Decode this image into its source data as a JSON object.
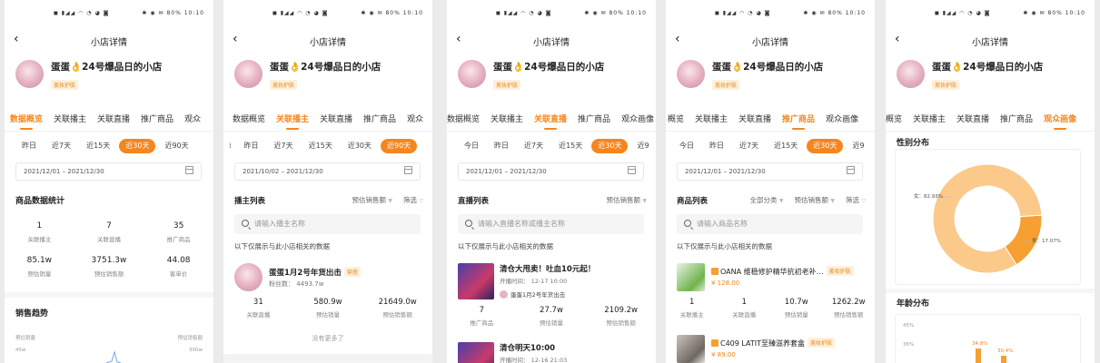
{
  "status_bar": {
    "left_icons": "◼ ▮◢◢ ◠ ◔ ◕ ◙",
    "right_icons": "✱ ◉ ✉",
    "battery": "80%",
    "time": "10:10"
  },
  "page_title": "小店详情",
  "shop": {
    "name_part1": "蛋蛋",
    "flame": "👌",
    "name_part2": "24号爆品日的小店",
    "badge": "美妆护肤"
  },
  "colors": {
    "accent": "#f5861f",
    "badge_bg": "#fdf0dd"
  },
  "panel1": {
    "tabs": [
      "数据概览",
      "关联播主",
      "关联直播",
      "推广商品",
      "观众"
    ],
    "active_tab": 0,
    "days": [
      "昨日",
      "近7天",
      "近15天",
      "近30天",
      "近90天"
    ],
    "active_day": 3,
    "date_range": "2021/12/01 – 2021/12/30",
    "stats_title": "商品数据统计",
    "stats": [
      {
        "value": "1",
        "label": "关联播主"
      },
      {
        "value": "7",
        "label": "关联直播"
      },
      {
        "value": "35",
        "label": "推广商品"
      },
      {
        "value": "85.1w",
        "label": "预估销量"
      },
      {
        "value": "3751.3w",
        "label": "预估销售额"
      },
      {
        "value": "44.08",
        "label": "客单价"
      }
    ],
    "trend_title": "销售趋势",
    "trend_legend_left": "预估销量",
    "trend_legend_right": "预估销售额",
    "trend_axis_left": "45w",
    "trend_axis_right": "300w"
  },
  "panel2": {
    "tabs": [
      "数据概览",
      "关联播主",
      "关联直播",
      "推广商品",
      "观众"
    ],
    "active_tab": 1,
    "days": [
      "",
      "昨日",
      "近7天",
      "近15天",
      "近30天",
      "近90天"
    ],
    "active_day": 5,
    "date_range": "2021/10/02 – 2021/12/30",
    "list_title": "播主列表",
    "sort_label": "预估销售额",
    "filter_label": "筛选",
    "search_placeholder": "请输入播主名称",
    "hint": "以下仅展示与此小店相关的数据",
    "item": {
      "title": "蛋蛋1月2号年货出击",
      "tag": "穿搭",
      "sub": "粉丝数： 4493.7w"
    },
    "item_stats": [
      {
        "value": "31",
        "label": "关联直播"
      },
      {
        "value": "580.9w",
        "label": "预估销量"
      },
      {
        "value": "21649.0w",
        "label": "预估销售额"
      }
    ],
    "no_more": "没有更多了"
  },
  "panel3": {
    "tabs": [
      "数据概览",
      "关联播主",
      "关联直播",
      "推广商品",
      "观众画像"
    ],
    "active_tab": 2,
    "days": [
      "今日",
      "昨日",
      "近7天",
      "近15天",
      "近30天",
      "近9"
    ],
    "active_day": 4,
    "date_range": "2021/12/01 – 2021/12/30",
    "list_title": "直播列表",
    "sort_label": "预估销售额",
    "search_placeholder": "请输入直播名称或播主名称",
    "hint": "以下仅展示与此小店相关的数据",
    "item1": {
      "title": "清仓大甩卖！吐血10元起！",
      "time": "开播时间：  12-17 10:00",
      "anchor": "蛋蛋1月2号年货出击"
    },
    "item1_stats": [
      {
        "value": "7",
        "label": "推广商品"
      },
      {
        "value": "27.7w",
        "label": "预估销量"
      },
      {
        "value": "2109.2w",
        "label": "预估销售额"
      }
    ],
    "item2": {
      "title": "清仓明天10:00",
      "time": "开播时间：  12-16 21:03"
    }
  },
  "panel4": {
    "tabs": [
      "概览",
      "关联播主",
      "关联直播",
      "推广商品",
      "观众画像"
    ],
    "active_tab": 3,
    "days": [
      "今日",
      "昨日",
      "近7天",
      "近15天",
      "近30天",
      "近9"
    ],
    "active_day": 4,
    "date_range": "2021/12/01 – 2021/12/30",
    "list_title": "商品列表",
    "category_label": "全部分类",
    "sort_label": "预估销售额",
    "filter_label": "筛选",
    "search_placeholder": "请输入商品名称",
    "hint": "以下仅展示与此小店相关的数据",
    "item1": {
      "title": "OANA 维稳修护精华抗初老补…",
      "tag": "美妆护肤",
      "price": "¥ 128.00"
    },
    "item1_stats": [
      {
        "value": "1",
        "label": "关联播主"
      },
      {
        "value": "1",
        "label": "关联直播"
      },
      {
        "value": "10.7w",
        "label": "预估销量"
      },
      {
        "value": "1262.2w",
        "label": "预估销售额"
      }
    ],
    "item2": {
      "title": "C409  LATIT至臻滋养套盒",
      "tag": "美妆护肤",
      "price": "¥ 89.00"
    }
  },
  "panel5": {
    "tabs": [
      "概览",
      "关联播主",
      "关联直播",
      "推广商品",
      "观众画像"
    ],
    "active_tab": 4,
    "gender_title": "性别分布",
    "age_title": "年龄分布",
    "gender_labels": {
      "female": "女：82.93%",
      "male": "男：17.07%"
    },
    "age_axis": [
      "45%",
      "36%"
    ],
    "age_values": [
      "34.8%",
      "30.4%"
    ]
  },
  "chart_data": {
    "type": "pie",
    "title": "性别分布",
    "categories": [
      "女",
      "男"
    ],
    "values": [
      82.93,
      17.07
    ],
    "colors": [
      "#fbc98a",
      "#f5a030"
    ]
  }
}
